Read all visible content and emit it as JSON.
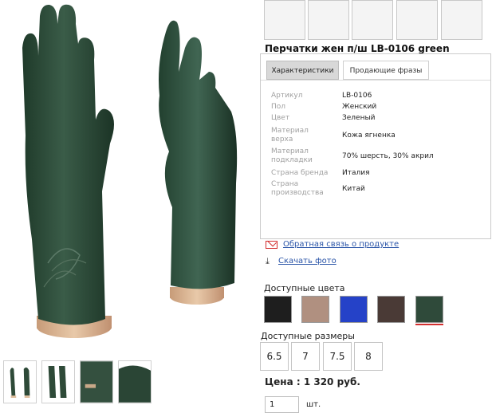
{
  "product": {
    "title": "Перчатки жен п/ш LB-0106 green"
  },
  "tabs": {
    "characteristics": "Характеристики",
    "selling_phrases": "Продающие фразы"
  },
  "specs": [
    {
      "label": "Артикул",
      "value": "LB-0106"
    },
    {
      "label": "Пол",
      "value": "Женский"
    },
    {
      "label": "Цвет",
      "value": "Зеленый"
    },
    {
      "label": "Материал верха",
      "value": "Кожа ягненка"
    },
    {
      "label": "Материал подкладки",
      "value": "70% шерсть, 30% акрил"
    },
    {
      "label": "Страна бренда",
      "value": "Италия"
    },
    {
      "label": "Страна производства",
      "value": "Китай"
    }
  ],
  "links": {
    "feedback": "Обратная связь о продукте",
    "download_photo": "Скачать фото"
  },
  "colors": {
    "label": "Доступные цвета",
    "swatches": [
      {
        "name": "black",
        "hex": "#1e1e1e"
      },
      {
        "name": "beige",
        "hex": "#b09080"
      },
      {
        "name": "blue",
        "hex": "#2542c8"
      },
      {
        "name": "brown",
        "hex": "#4a3a36"
      },
      {
        "name": "green",
        "hex": "#2f4a3a",
        "selected": true
      }
    ]
  },
  "sizes": {
    "label": "Доступные размеры",
    "options": [
      "6.5",
      "7",
      "7.5",
      "8"
    ]
  },
  "price": {
    "text": "Цена : 1 320 руб."
  },
  "quantity": {
    "value": "1",
    "unit": "шт."
  },
  "theme": {
    "glove_color": "#2e4a38",
    "link_color": "#2b55a8",
    "accent_red": "#d32f2f"
  }
}
